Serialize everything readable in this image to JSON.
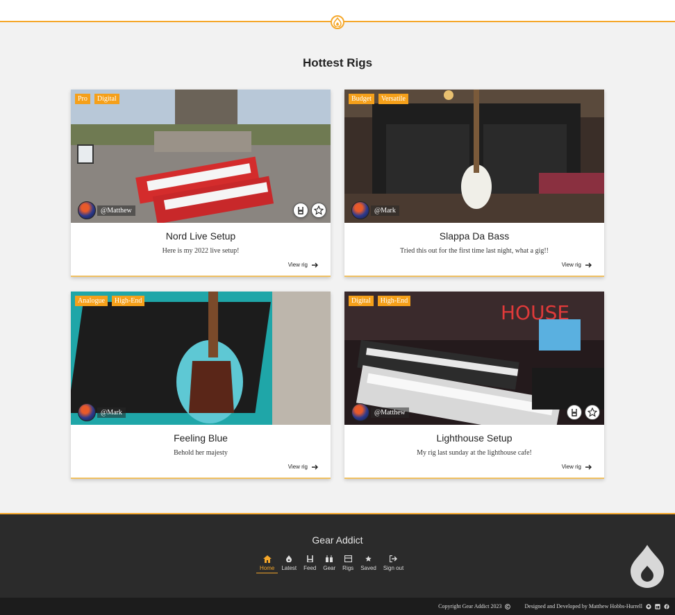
{
  "page": {
    "title": "Hottest Rigs"
  },
  "rigs": [
    {
      "title": "Nord Live Setup",
      "description": "Here is my 2022 live setup!",
      "tags": [
        "Pro",
        "Digital"
      ],
      "user": "@Matthew",
      "view_label": "View rig",
      "show_actions": true
    },
    {
      "title": "Slappa Da Bass",
      "description": "Tried this out for the first time last night, what a gig!!",
      "tags": [
        "Budget",
        "Versatile"
      ],
      "user": "@Mark",
      "view_label": "View rig",
      "show_actions": false
    },
    {
      "title": "Feeling Blue",
      "description": "Behold her majesty",
      "tags": [
        "Analogue",
        "High-End"
      ],
      "user": "@Mark",
      "view_label": "View rig",
      "show_actions": false
    },
    {
      "title": "Lighthouse Setup",
      "description": "My rig last sunday at the lighthouse cafe!",
      "tags": [
        "Digital",
        "High-End"
      ],
      "user": "@Matthew",
      "view_label": "View rig",
      "show_actions": true
    }
  ],
  "footer": {
    "brand": "Gear Addict",
    "nav": [
      {
        "label": "Home",
        "icon": "home-icon",
        "active": true
      },
      {
        "label": "Latest",
        "icon": "flame-icon",
        "active": false
      },
      {
        "label": "Feed",
        "icon": "rock-hand-icon",
        "active": false
      },
      {
        "label": "Gear",
        "icon": "guitar-pedals-icon",
        "active": false
      },
      {
        "label": "Rigs",
        "icon": "box-icon",
        "active": false
      },
      {
        "label": "Saved",
        "icon": "star-icon",
        "active": false
      },
      {
        "label": "Sign out",
        "icon": "sign-out-icon",
        "active": false
      }
    ],
    "copyright": "Copyright Gear Addict 2023",
    "credit": "Designed and Developed by Matthew Hobbs-Hurrell"
  },
  "colors": {
    "accent": "#f5a72a",
    "footer_bg": "#2b2b2b",
    "bottom_bar": "#1c1c1c"
  }
}
